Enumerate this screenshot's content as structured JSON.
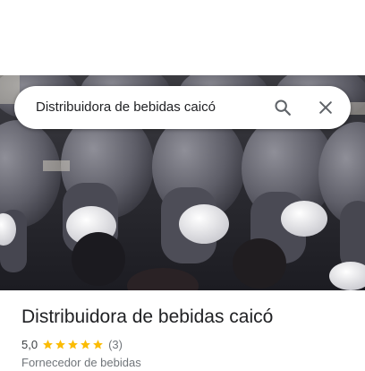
{
  "search": {
    "query": "Distribuidora de bebidas caicó",
    "search_icon": "search-icon",
    "close_icon": "close-icon"
  },
  "photo": {
    "description_icon": "bottles-photo"
  },
  "place": {
    "name": "Distribuidora de bebidas caicó",
    "rating": "5,0",
    "rating_stars": 5,
    "reviews": "(3)",
    "category": "Fornecedor de bebidas"
  },
  "colors": {
    "star": "#fbbc04",
    "icon": "#5f6368",
    "title": "#202124",
    "muted": "#70757a"
  }
}
